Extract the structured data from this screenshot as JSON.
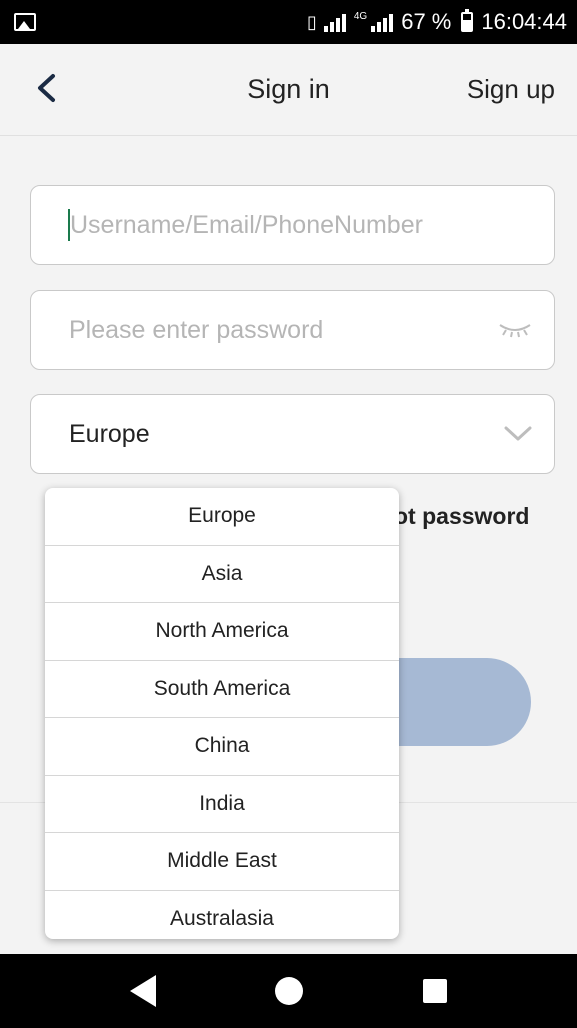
{
  "status_bar": {
    "battery": "67 %",
    "time": "16:04:44",
    "network": "4G",
    "icons": [
      "image-icon",
      "vibrate-icon",
      "signal-icon",
      "signal-4g-icon",
      "battery-icon"
    ]
  },
  "header": {
    "title": "Sign in",
    "signup_label": "Sign up",
    "back_icon": "chevron-left-icon"
  },
  "form": {
    "username_placeholder": "Username/Email/PhoneNumber",
    "password_placeholder": "Please enter password",
    "region_value": "Europe",
    "forgot_label": "ot password"
  },
  "dropdown": {
    "options": [
      "Europe",
      "Asia",
      "North America",
      "South America",
      "China",
      "India",
      "Middle East",
      "Australasia"
    ]
  },
  "colors": {
    "accent_cursor": "#1a7a4c",
    "signin_disabled": "#a6b9d4"
  }
}
